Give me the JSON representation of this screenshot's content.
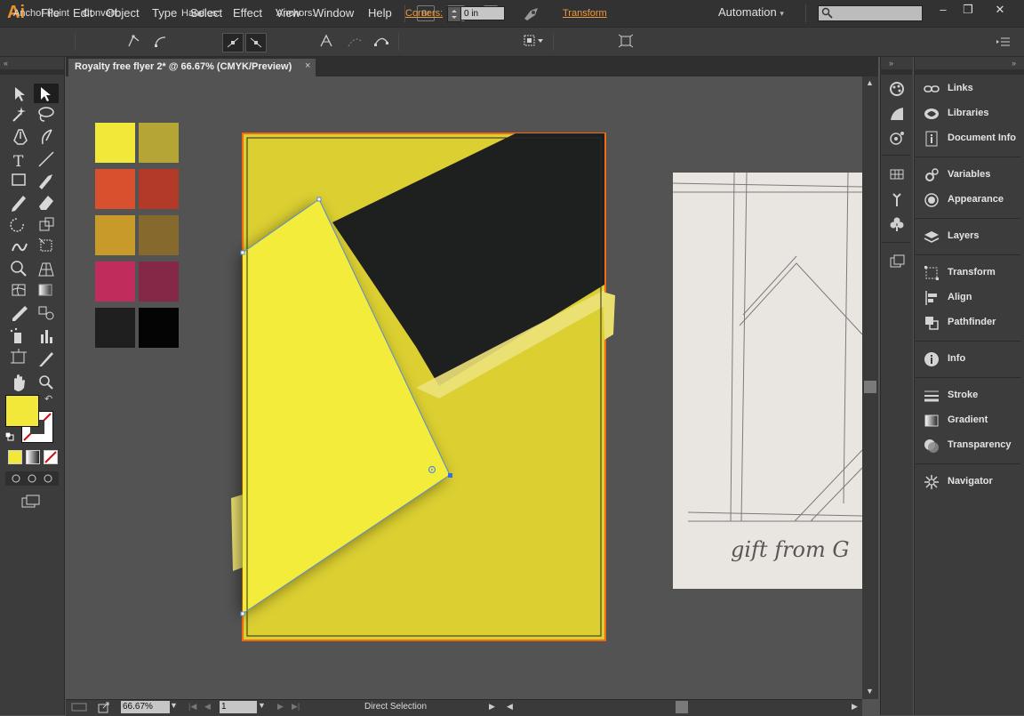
{
  "app": {
    "logo": "Ai"
  },
  "menu": [
    "File",
    "Edit",
    "Object",
    "Type",
    "Select",
    "Effect",
    "View",
    "Window",
    "Help"
  ],
  "menu_extra": {
    "br": "Br",
    "st": "St",
    "workspace": "Automation",
    "workspace_caret": "▾"
  },
  "window_buttons": {
    "minimize": "–",
    "restore": "❐",
    "close": "✕"
  },
  "control_bar": {
    "anchor_point": "Anchor Point",
    "convert": "Convert:",
    "handles": "Handles:",
    "anchors": "Anchors:",
    "corners": "Corners:",
    "corners_value": "0 in",
    "transform": "Transform"
  },
  "document_tab": {
    "title": "Royalty free flyer 2* @ 66.67% (CMYK/Preview)",
    "close": "×"
  },
  "status_bar": {
    "zoom": "66.67%",
    "page": "1",
    "tool": "Direct Selection"
  },
  "swatches": {
    "colors": [
      "#f2e83a",
      "#b5a534",
      "#d8502e",
      "#b33a28",
      "#c89a2a",
      "#86692c",
      "#c02c5c",
      "#852848",
      "#1f1f1f",
      "#040404"
    ]
  },
  "artwork": {
    "background": "#dbcf31",
    "dark_shape": "#1e1f1f",
    "light_shape": "#f3ec3a",
    "sketch_text": "gift from G"
  },
  "fill_color": "#f2e83a",
  "panels": [
    {
      "label": "Links",
      "icon": "links-icon"
    },
    {
      "label": "Libraries",
      "icon": "libraries-icon"
    },
    {
      "label": "Document Info",
      "icon": "document-info-icon"
    },
    {
      "label": "Variables",
      "icon": "variables-icon"
    },
    {
      "label": "Appearance",
      "icon": "appearance-icon"
    },
    {
      "label": "Layers",
      "icon": "layers-icon"
    },
    {
      "label": "Transform",
      "icon": "transform-icon"
    },
    {
      "label": "Align",
      "icon": "align-icon"
    },
    {
      "label": "Pathfinder",
      "icon": "pathfinder-icon"
    },
    {
      "label": "Info",
      "icon": "info-icon"
    },
    {
      "label": "Stroke",
      "icon": "stroke-icon"
    },
    {
      "label": "Gradient",
      "icon": "gradient-icon"
    },
    {
      "label": "Transparency",
      "icon": "transparency-icon"
    },
    {
      "label": "Navigator",
      "icon": "navigator-icon"
    }
  ]
}
